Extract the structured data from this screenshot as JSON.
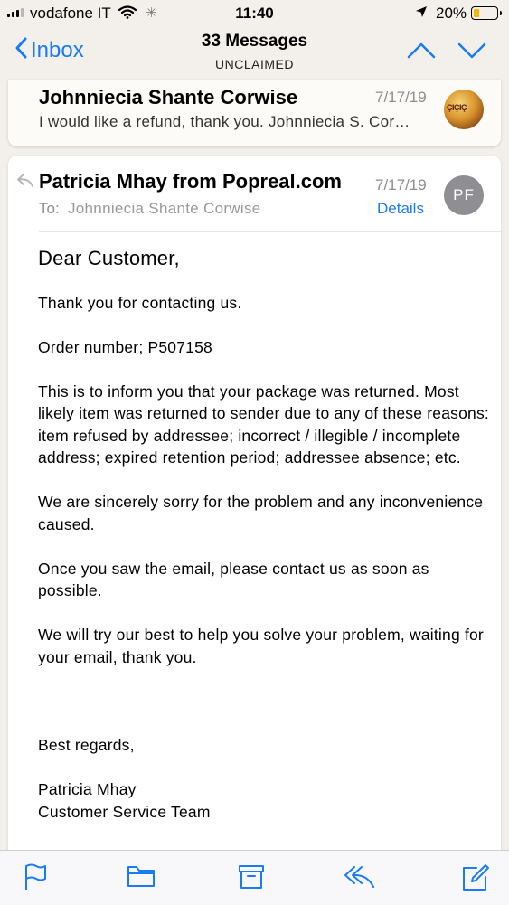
{
  "status_bar": {
    "carrier": "vodafone IT",
    "time": "11:40",
    "battery_percent": "20%",
    "battery_level": 0.2,
    "icons": [
      "signal-icon",
      "wifi-icon",
      "activity-spinner-icon",
      "location-arrow-icon",
      "battery-icon"
    ]
  },
  "nav": {
    "back_label": "Inbox",
    "title": "33 Messages",
    "subtitle": "UNCLAIMED",
    "icons": [
      "chevron-left-icon",
      "chevron-up-icon",
      "chevron-down-icon"
    ],
    "accent_color": "#1a7cf5"
  },
  "collapsed_message": {
    "sender": "Johnniecia Shante Corwise",
    "date": "7/17/19",
    "snippet": "I would like a refund, thank you. Johnniecia S. Cor…",
    "avatar_icon": "photo-avatar"
  },
  "message": {
    "from": "Patricia Mhay from Popreal.com",
    "date": "7/17/19",
    "to_label": "To:",
    "to": "Johnniecia Shante Corwise",
    "details_label": "Details",
    "avatar_initials": "PF",
    "avatar_color": "#8e8e93",
    "greeting": "Dear  Customer,",
    "p1": "Thank you for contacting us.",
    "order_label": "Order number; ",
    "order_number": "P507158",
    "p3": "This is to inform you that your package was returned. Most likely item was returned to sender due to any of these reasons: item refused by addressee; incorrect / illegible / incomplete address; expired retention period; addressee absence; etc.",
    "p4": "We are sincerely sorry for the problem and any inconvenience caused.",
    "p5": "Once you saw the email, please contact us as soon as possible.",
    "p6": "We will try our best to help you solve your problem, waiting for your email, thank you.",
    "signoff": "Best regards,",
    "sig_name": "Patricia Mhay",
    "sig_team": "Customer Service Team"
  },
  "toolbar": {
    "icons": [
      "flag-icon",
      "folder-icon",
      "archive-box-icon",
      "reply-icon",
      "compose-icon"
    ]
  }
}
